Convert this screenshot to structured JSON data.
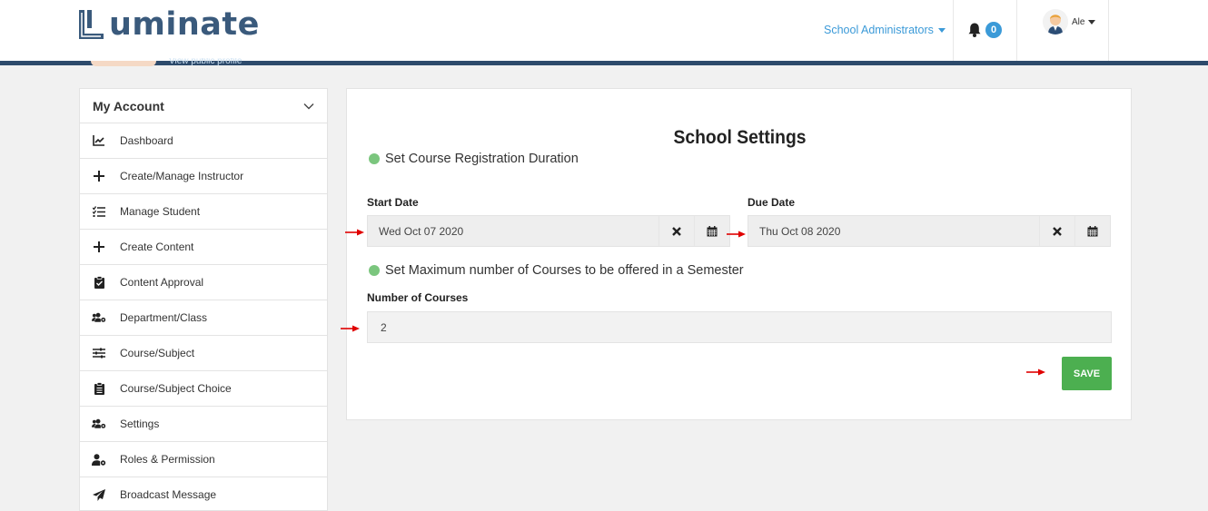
{
  "header": {
    "logo_text": "uminate",
    "role_menu_label": "School Administrators",
    "notification_count": "0",
    "user_name": "Ale",
    "profile_link": "View public profile"
  },
  "sidebar": {
    "title": "My Account",
    "items": [
      {
        "label": "Dashboard",
        "icon": "chart-icon"
      },
      {
        "label": "Create/Manage Instructor",
        "icon": "plus-icon"
      },
      {
        "label": "Manage Student",
        "icon": "list-check-icon"
      },
      {
        "label": "Create Content",
        "icon": "plus-icon"
      },
      {
        "label": "Content Approval",
        "icon": "clipboard-check-icon"
      },
      {
        "label": "Department/Class",
        "icon": "users-cog-icon"
      },
      {
        "label": "Course/Subject",
        "icon": "sliders-icon"
      },
      {
        "label": "Course/Subject Choice",
        "icon": "clipboard-list-icon"
      },
      {
        "label": "Settings",
        "icon": "users-cog-icon"
      },
      {
        "label": "Roles & Permission",
        "icon": "user-cog-icon"
      },
      {
        "label": "Broadcast Message",
        "icon": "paper-plane-icon"
      }
    ]
  },
  "main": {
    "title": "School Settings",
    "section_registration": "Set Course Registration Duration",
    "start_date_label": "Start Date",
    "start_date_value": "Wed Oct 07 2020",
    "due_date_label": "Due Date",
    "due_date_value": "Thu Oct 08 2020",
    "section_max_courses": "Set Maximum number of Courses to be offered in a Semester",
    "num_courses_label": "Number of Courses",
    "num_courses_value": "2",
    "save_label": "SAVE"
  },
  "colors": {
    "accent_blue": "#3b9ad8",
    "header_line": "#2d4a6b",
    "save_green": "#4caf50",
    "section_dot": "#7bc67e",
    "annotation_arrow": "#e00000"
  }
}
